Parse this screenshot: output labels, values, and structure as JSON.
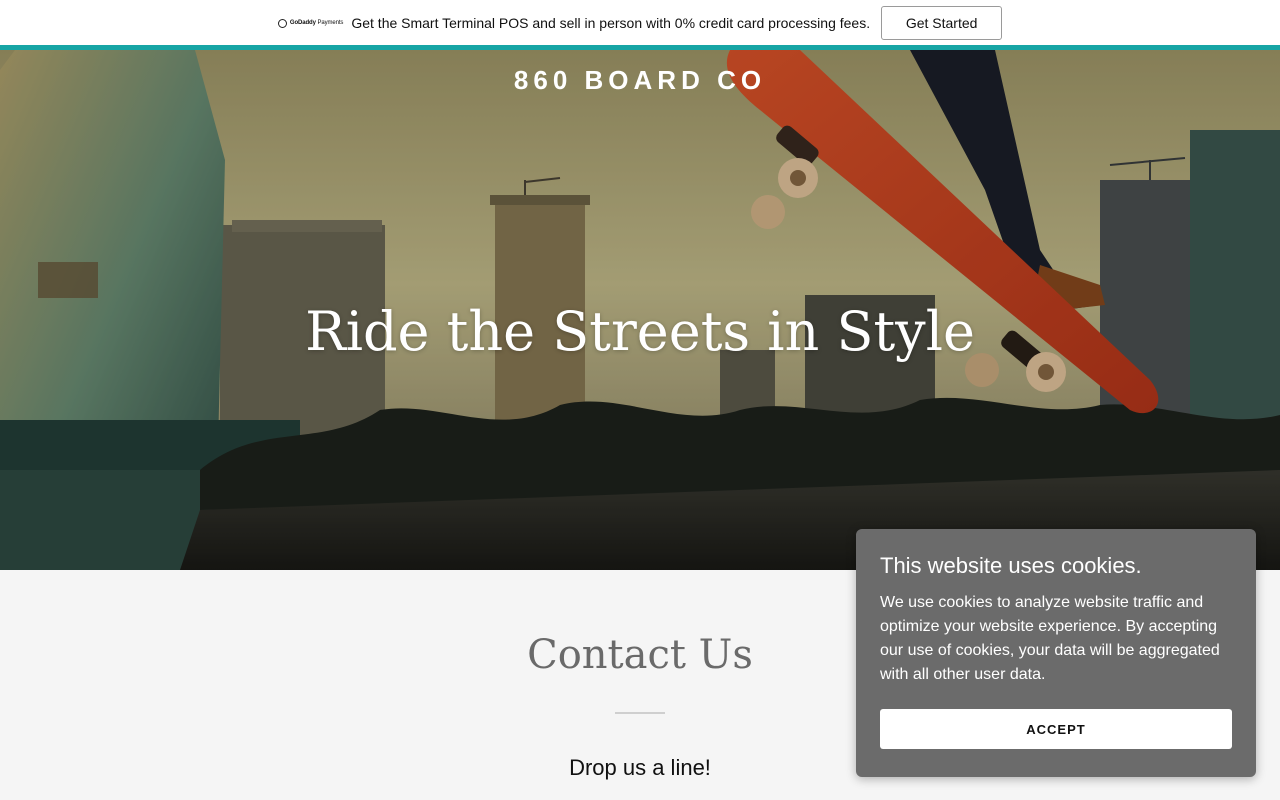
{
  "promo": {
    "logo_text_bold": "GoDaddy",
    "logo_text": "Payments",
    "message": "Get the Smart Terminal POS and sell in person with 0% credit card processing fees.",
    "cta_label": "Get Started",
    "accent_color": "#17a5a5"
  },
  "hero": {
    "brand": "860 BOARD CO",
    "headline": "Ride the Streets in Style"
  },
  "contact": {
    "title": "Contact Us",
    "subtitle": "Drop us a line!"
  },
  "cookie": {
    "title": "This website uses cookies.",
    "body": "We use cookies to analyze website traffic and optimize your website experience. By accepting our use of cookies, your data will be aggregated with all other user data.",
    "accept_label": "ACCEPT"
  }
}
